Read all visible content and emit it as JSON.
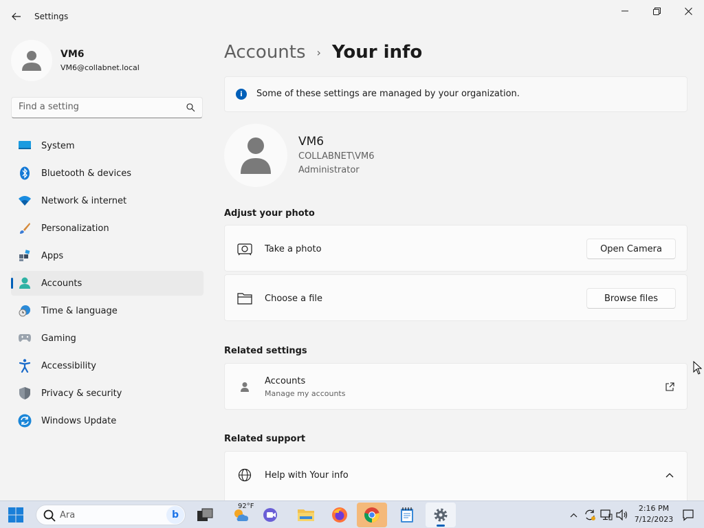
{
  "window": {
    "title": "Settings"
  },
  "profile": {
    "name": "VM6",
    "email": "VM6@collabnet.local"
  },
  "search": {
    "placeholder": "Find a setting"
  },
  "sidebar": {
    "items": [
      {
        "label": "System",
        "icon": "system-icon"
      },
      {
        "label": "Bluetooth & devices",
        "icon": "bluetooth-icon"
      },
      {
        "label": "Network & internet",
        "icon": "wifi-icon"
      },
      {
        "label": "Personalization",
        "icon": "brush-icon"
      },
      {
        "label": "Apps",
        "icon": "apps-icon"
      },
      {
        "label": "Accounts",
        "icon": "accounts-icon",
        "active": true
      },
      {
        "label": "Time & language",
        "icon": "globe-clock-icon"
      },
      {
        "label": "Gaming",
        "icon": "gamepad-icon"
      },
      {
        "label": "Accessibility",
        "icon": "accessibility-icon"
      },
      {
        "label": "Privacy & security",
        "icon": "shield-icon"
      },
      {
        "label": "Windows Update",
        "icon": "update-icon"
      }
    ]
  },
  "breadcrumb": {
    "parent": "Accounts",
    "separator": "›",
    "current": "Your info"
  },
  "info_bar": {
    "text": "Some of these settings are managed by your organization."
  },
  "user": {
    "name": "VM6",
    "domain": "COLLABNET\\VM6",
    "role": "Administrator"
  },
  "adjust_photo": {
    "title": "Adjust your photo",
    "take_photo_label": "Take a photo",
    "open_camera_label": "Open Camera",
    "choose_file_label": "Choose a file",
    "browse_files_label": "Browse files"
  },
  "related_settings": {
    "title": "Related settings",
    "accounts_label": "Accounts",
    "accounts_sub": "Manage my accounts"
  },
  "related_support": {
    "title": "Related support",
    "help_label": "Help with Your info"
  },
  "taskbar": {
    "search_text": "Ara",
    "weather_temp": "92°F",
    "time": "2:16 PM",
    "date": "7/12/2023"
  },
  "colors": {
    "accent": "#005fb8",
    "background": "#f3f3f3",
    "taskbar": "#dde3ee"
  }
}
